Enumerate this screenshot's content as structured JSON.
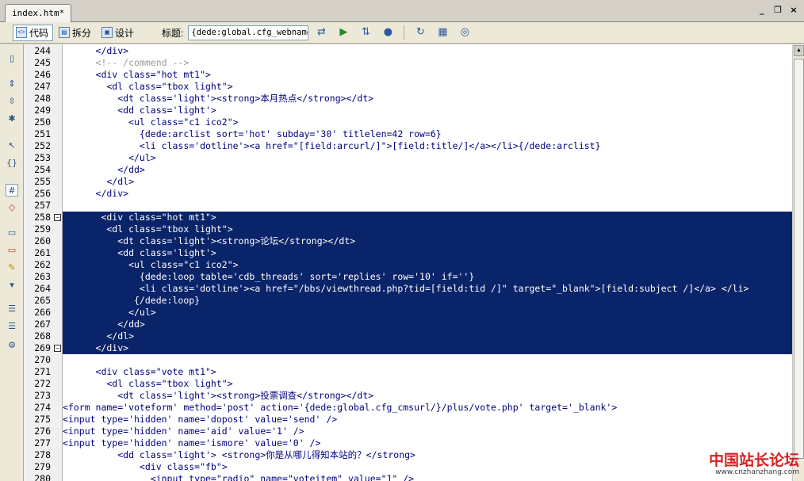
{
  "tab": {
    "title": "index.htm*"
  },
  "window_controls": {
    "minimize": "_",
    "restore": "❐",
    "close": "×"
  },
  "toolbar": {
    "code_label": "代码",
    "split_label": "拆分",
    "design_label": "设计",
    "title_label": "标题:",
    "title_value": "{dede:global.cfg_webname/"
  },
  "lines": [
    {
      "n": "244",
      "text": "      </div>",
      "sel": false,
      "fold": false
    },
    {
      "n": "245",
      "text": "      <!-- /commend -->",
      "sel": false,
      "fold": false
    },
    {
      "n": "246",
      "text": "      <div class=\"hot mt1\">",
      "sel": false,
      "fold": false
    },
    {
      "n": "247",
      "text": "        <dl class=\"tbox light\">",
      "sel": false,
      "fold": false
    },
    {
      "n": "248",
      "text": "          <dt class='light'><strong>本月热点</strong></dt>",
      "sel": false,
      "fold": false
    },
    {
      "n": "249",
      "text": "          <dd class='light'>",
      "sel": false,
      "fold": false
    },
    {
      "n": "250",
      "text": "            <ul class=\"c1 ico2\">",
      "sel": false,
      "fold": false
    },
    {
      "n": "251",
      "text": "              {dede:arclist sort='hot' subday='30' titlelen=42 row=6}",
      "sel": false,
      "fold": false
    },
    {
      "n": "252",
      "text": "              <li class='dotline'><a href=\"[field:arcurl/]\">[field:title/]</a></li>{/dede:arclist}",
      "sel": false,
      "fold": false
    },
    {
      "n": "253",
      "text": "            </ul>",
      "sel": false,
      "fold": false
    },
    {
      "n": "254",
      "text": "          </dd>",
      "sel": false,
      "fold": false
    },
    {
      "n": "255",
      "text": "        </dl>",
      "sel": false,
      "fold": false
    },
    {
      "n": "256",
      "text": "      </div>",
      "sel": false,
      "fold": false
    },
    {
      "n": "257",
      "text": "",
      "sel": false,
      "fold": false
    },
    {
      "n": "258",
      "text": "       <div class=\"hot mt1\">",
      "sel": true,
      "fold": true
    },
    {
      "n": "259",
      "text": "        <dl class=\"tbox light\">",
      "sel": true,
      "fold": false
    },
    {
      "n": "260",
      "text": "          <dt class='light'><strong>论坛</strong></dt>",
      "sel": true,
      "fold": false
    },
    {
      "n": "261",
      "text": "          <dd class='light'>",
      "sel": true,
      "fold": false
    },
    {
      "n": "262",
      "text": "            <ul class=\"c1 ico2\">",
      "sel": true,
      "fold": false
    },
    {
      "n": "263",
      "text": "              {dede:loop table='cdb_threads' sort='replies' row='10' if=''}",
      "sel": true,
      "fold": false
    },
    {
      "n": "264",
      "text": "              <li class='dotline'><a href=\"/bbs/viewthread.php?tid=[field:tid /]\" target=\"_blank\">[field:subject /]</a> </li>",
      "sel": true,
      "fold": false
    },
    {
      "n": "265",
      "text": "             {/dede:loop}",
      "sel": true,
      "fold": false
    },
    {
      "n": "266",
      "text": "            </ul>",
      "sel": true,
      "fold": false
    },
    {
      "n": "267",
      "text": "          </dd>",
      "sel": true,
      "fold": false
    },
    {
      "n": "268",
      "text": "        </dl>",
      "sel": true,
      "fold": false
    },
    {
      "n": "269",
      "text": "      </div>",
      "sel": true,
      "fold": true
    },
    {
      "n": "270",
      "text": "",
      "sel": false,
      "fold": false
    },
    {
      "n": "271",
      "text": "      <div class=\"vote mt1\">",
      "sel": false,
      "fold": false
    },
    {
      "n": "272",
      "text": "        <dl class=\"tbox light\">",
      "sel": false,
      "fold": false
    },
    {
      "n": "273",
      "text": "          <dt class='light'><strong>投票调查</strong></dt>",
      "sel": false,
      "fold": false
    },
    {
      "n": "274",
      "text": "<form name='voteform' method='post' action='{dede:global.cfg_cmsurl/}/plus/vote.php' target='_blank'>",
      "sel": false,
      "fold": false
    },
    {
      "n": "275",
      "text": "<input type='hidden' name='dopost' value='send' />",
      "sel": false,
      "fold": false
    },
    {
      "n": "276",
      "text": "<input type='hidden' name='aid' value='1' />",
      "sel": false,
      "fold": false
    },
    {
      "n": "277",
      "text": "<input type='hidden' name='ismore' value='0' />",
      "sel": false,
      "fold": false
    },
    {
      "n": "278",
      "text": "          <dd class='light'> <strong>你是从哪儿得知本站的？</strong>",
      "sel": false,
      "fold": false
    },
    {
      "n": "279",
      "text": "              <div class=\"fb\">",
      "sel": false,
      "fold": false
    },
    {
      "n": "280",
      "text": "                <input type=\"radio\" name=\"voteitem\" value=\"1\" />",
      "sel": false,
      "fold": false
    }
  ],
  "watermark": {
    "title": "中国站长论坛",
    "url": "www.cnzhanzhang.com",
    "color": "#d62020"
  },
  "colors": {
    "selection": "#0a246a",
    "tag": "#000080",
    "comment": "#999999"
  }
}
